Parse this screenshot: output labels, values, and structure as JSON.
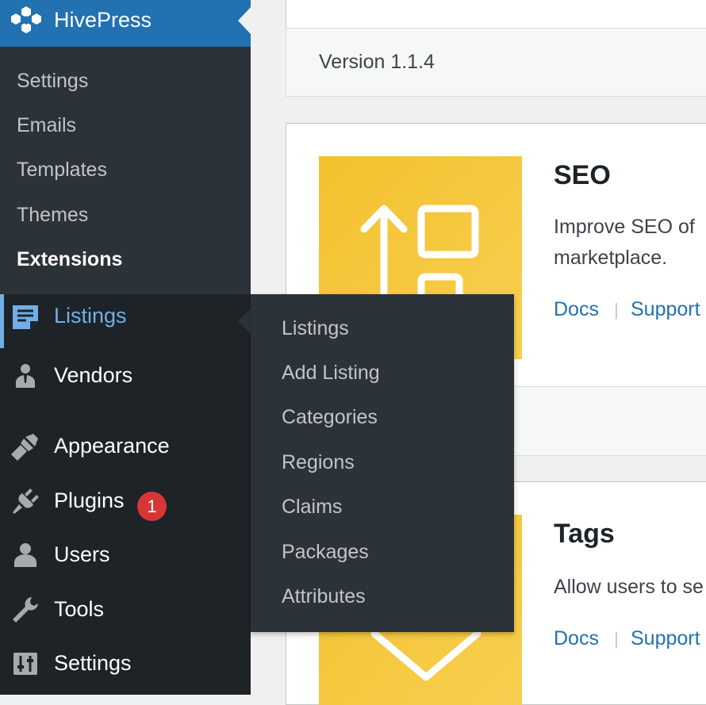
{
  "sidebar": {
    "top": {
      "label": "HivePress"
    },
    "submenu": [
      "Settings",
      "Emails",
      "Templates",
      "Themes",
      "Extensions"
    ],
    "items": [
      {
        "label": "Listings",
        "icon": "listings-icon"
      },
      {
        "label": "Vendors",
        "icon": "vendors-icon"
      },
      {
        "label": "Appearance",
        "icon": "appearance-icon"
      },
      {
        "label": "Plugins",
        "icon": "plugins-icon",
        "badge": "1"
      },
      {
        "label": "Users",
        "icon": "users-icon"
      },
      {
        "label": "Tools",
        "icon": "tools-icon"
      },
      {
        "label": "Settings",
        "icon": "settings-icon"
      }
    ]
  },
  "flyout": {
    "items": [
      "Listings",
      "Add Listing",
      "Categories",
      "Regions",
      "Claims",
      "Packages",
      "Attributes"
    ]
  },
  "content": {
    "version": "Version 1.1.4",
    "extensions": [
      {
        "title": "SEO",
        "description": [
          "Improve SEO of",
          "marketplace."
        ],
        "docs": "Docs",
        "separator": "|",
        "support": "Support"
      },
      {
        "title": "Tags",
        "description": [
          "Allow users to se"
        ],
        "docs": "Docs",
        "separator": "|",
        "support": "Support"
      }
    ]
  },
  "colors": {
    "sidebar": "#1d2327",
    "submenu": "#2c3338",
    "accent": "#2271b1",
    "hover": "#72aee6",
    "badge": "#d63638",
    "thumb": "#f4c12e"
  }
}
